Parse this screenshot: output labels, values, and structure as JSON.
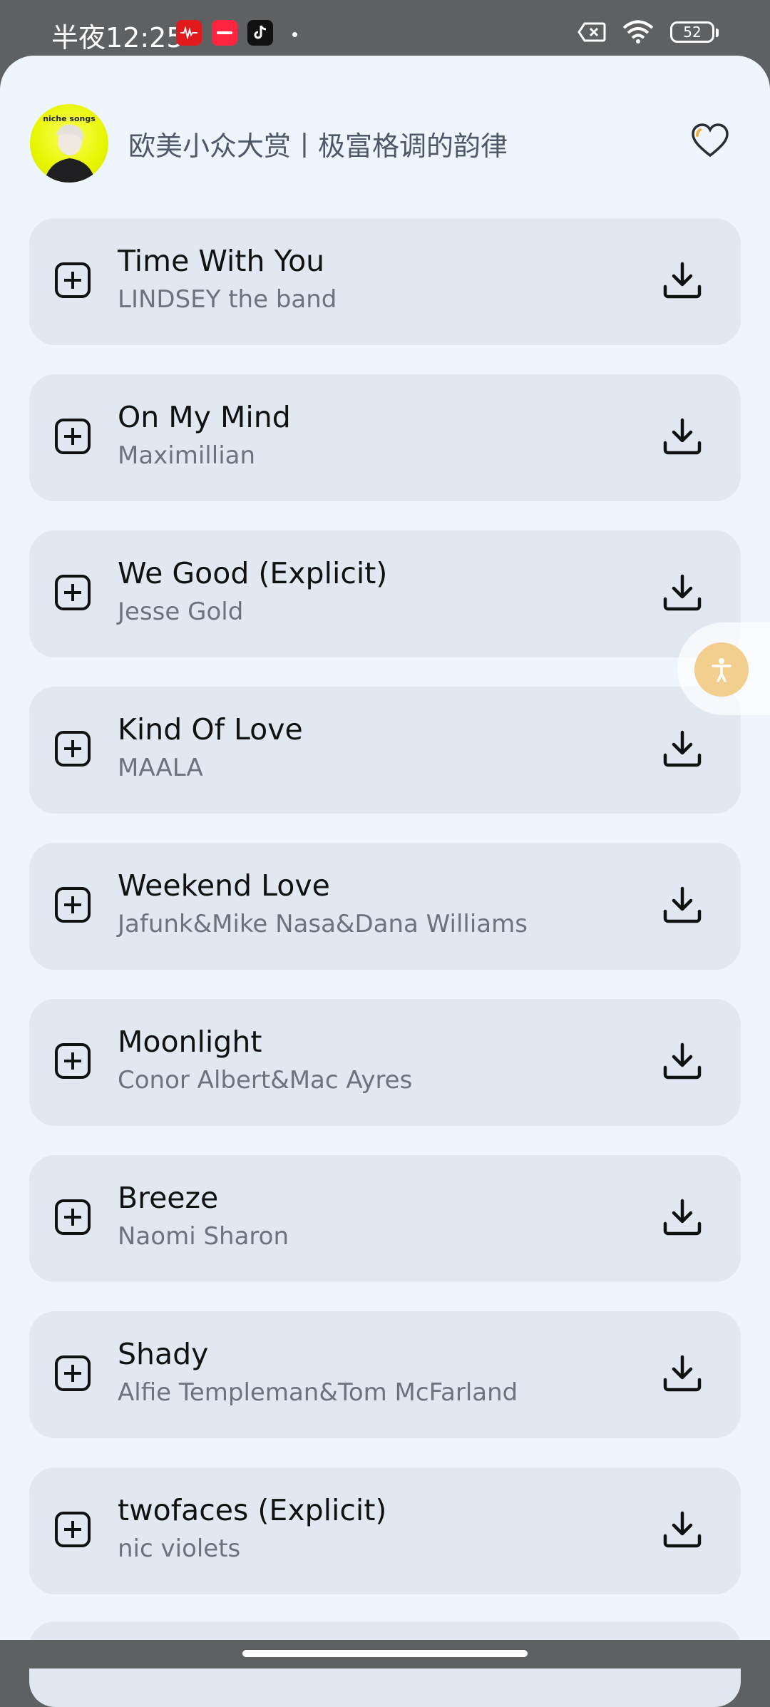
{
  "status_bar": {
    "time": "半夜12:25",
    "battery": "52",
    "apps": [
      "netease-music-icon",
      "xiaohongshu-icon",
      "tiktok-icon"
    ]
  },
  "header": {
    "playlist_title": "欧美小众大赏丨极富格调的韵律",
    "cover_text": "niche songs"
  },
  "songs": [
    {
      "title": "Time With You",
      "artist": "LINDSEY the band"
    },
    {
      "title": "On My Mind",
      "artist": "Maximillian"
    },
    {
      "title": "We Good (Explicit)",
      "artist": "Jesse Gold"
    },
    {
      "title": "Kind Of Love",
      "artist": "MAALA"
    },
    {
      "title": "Weekend Love",
      "artist": "Jafunk&Mike Nasa&Dana Williams"
    },
    {
      "title": "Moonlight",
      "artist": "Conor Albert&Mac Ayres"
    },
    {
      "title": "Breeze",
      "artist": "Naomi Sharon"
    },
    {
      "title": "Shady",
      "artist": "Alfie Templeman&Tom McFarland"
    },
    {
      "title": "twofaces (Explicit)",
      "artist": "nic violets"
    }
  ],
  "colors": {
    "sheet_bg": "#eef5fd",
    "row_bg": "#e1e8f1",
    "accent_float": "#f3cf8f"
  }
}
